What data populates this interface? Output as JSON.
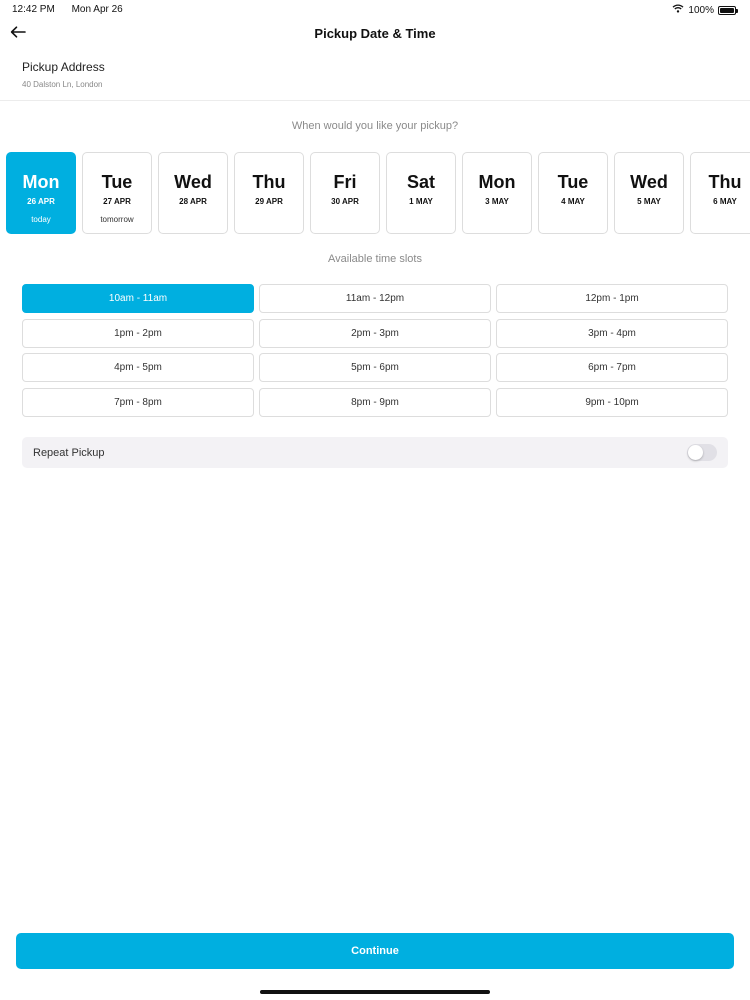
{
  "status_bar": {
    "time": "12:42 PM",
    "date": "Mon Apr 26",
    "battery": "100%"
  },
  "nav": {
    "title": "Pickup Date & Time"
  },
  "address": {
    "label": "Pickup Address",
    "value": "40 Dalston Ln, London"
  },
  "date_prompt": "When would you like your pickup?",
  "dates": [
    {
      "day": "Mon",
      "date": "26 APR",
      "note": "today",
      "selected": true
    },
    {
      "day": "Tue",
      "date": "27 APR",
      "note": "tomorrow",
      "selected": false
    },
    {
      "day": "Wed",
      "date": "28 APR",
      "note": "",
      "selected": false
    },
    {
      "day": "Thu",
      "date": "29 APR",
      "note": "",
      "selected": false
    },
    {
      "day": "Fri",
      "date": "30 APR",
      "note": "",
      "selected": false
    },
    {
      "day": "Sat",
      "date": "1 MAY",
      "note": "",
      "selected": false
    },
    {
      "day": "Mon",
      "date": "3 MAY",
      "note": "",
      "selected": false
    },
    {
      "day": "Tue",
      "date": "4 MAY",
      "note": "",
      "selected": false
    },
    {
      "day": "Wed",
      "date": "5 MAY",
      "note": "",
      "selected": false
    },
    {
      "day": "Thu",
      "date": "6 MAY",
      "note": "",
      "selected": false
    }
  ],
  "slots_title": "Available time slots",
  "slots": [
    {
      "label": "10am - 11am",
      "selected": true
    },
    {
      "label": "11am - 12pm",
      "selected": false
    },
    {
      "label": "12pm - 1pm",
      "selected": false
    },
    {
      "label": "1pm - 2pm",
      "selected": false
    },
    {
      "label": "2pm - 3pm",
      "selected": false
    },
    {
      "label": "3pm - 4pm",
      "selected": false
    },
    {
      "label": "4pm - 5pm",
      "selected": false
    },
    {
      "label": "5pm - 6pm",
      "selected": false
    },
    {
      "label": "6pm - 7pm",
      "selected": false
    },
    {
      "label": "7pm - 8pm",
      "selected": false
    },
    {
      "label": "8pm - 9pm",
      "selected": false
    },
    {
      "label": "9pm - 10pm",
      "selected": false
    }
  ],
  "repeat": {
    "label": "Repeat Pickup",
    "enabled": false
  },
  "continue_label": "Continue",
  "icons": {
    "back": "back-arrow-icon",
    "wifi": "wifi-icon",
    "battery": "battery-icon"
  },
  "colors": {
    "accent": "#00afe0",
    "text": "#222222",
    "muted": "#8a8a8a",
    "border": "#dddddd",
    "repeat_bg": "#f3f2f5"
  }
}
